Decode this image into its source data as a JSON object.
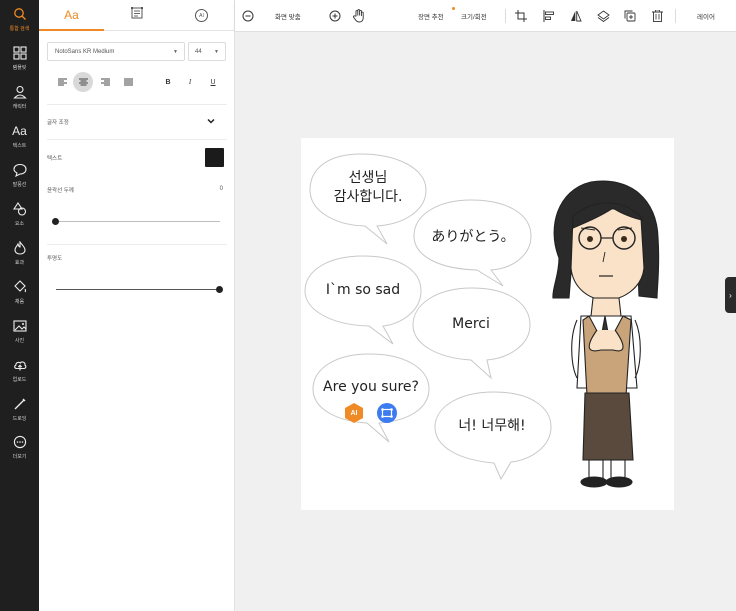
{
  "sidebar": {
    "items": [
      {
        "label": "통합 검색",
        "icon": "search-icon",
        "active": true
      },
      {
        "label": "템플릿",
        "icon": "grid-icon"
      },
      {
        "label": "캐릭터",
        "icon": "person-icon"
      },
      {
        "label": "텍스트",
        "icon": "text-icon"
      },
      {
        "label": "말풍선",
        "icon": "speech-bubble-icon"
      },
      {
        "label": "요소",
        "icon": "shapes-icon"
      },
      {
        "label": "효과",
        "icon": "fire-icon"
      },
      {
        "label": "채움",
        "icon": "paint-bucket-icon"
      },
      {
        "label": "사진",
        "icon": "image-icon"
      },
      {
        "label": "업로드",
        "icon": "upload-cloud-icon"
      },
      {
        "label": "드로잉",
        "icon": "pen-icon"
      },
      {
        "label": "더보기",
        "icon": "more-icon"
      }
    ]
  },
  "panel": {
    "tabs": [
      {
        "label": "Aa",
        "icon": "text-style-icon",
        "active": true
      },
      {
        "label": "",
        "icon": "transform-icon"
      },
      {
        "label": "AI",
        "icon": "ai-icon"
      }
    ],
    "font_family": "NotoSans KR Medium",
    "font_size": "44",
    "letter_spacing_label": "글자 조정",
    "text_color_label": "텍스트",
    "text_color": "#1b1b1b",
    "outline_label": "윤곽선 두께",
    "outline_value": "0",
    "outline_fraction": 0.0,
    "opacity_label": "투명도",
    "opacity_fraction": 1.0,
    "format_buttons": {
      "bold": "B",
      "italic": "I",
      "underline": "U"
    }
  },
  "toolbar": {
    "fit_label": "화면 맞춤",
    "recommend_label": "장면 추천",
    "size_rotate_label": "크기/회전",
    "layer_label": "레이어"
  },
  "canvas": {
    "bubbles": [
      {
        "text": "선생님\n감사합니다."
      },
      {
        "text": "ありがとう。"
      },
      {
        "text": "I`m so sad"
      },
      {
        "text": "Merci"
      },
      {
        "text": "Are you sure?"
      },
      {
        "text": "너! 너무해!"
      }
    ],
    "ai_badge": "AI"
  },
  "colors": {
    "accent": "#f08a24",
    "rail_bg": "#1f1f1f",
    "handle_blue": "#3d7bf0"
  }
}
